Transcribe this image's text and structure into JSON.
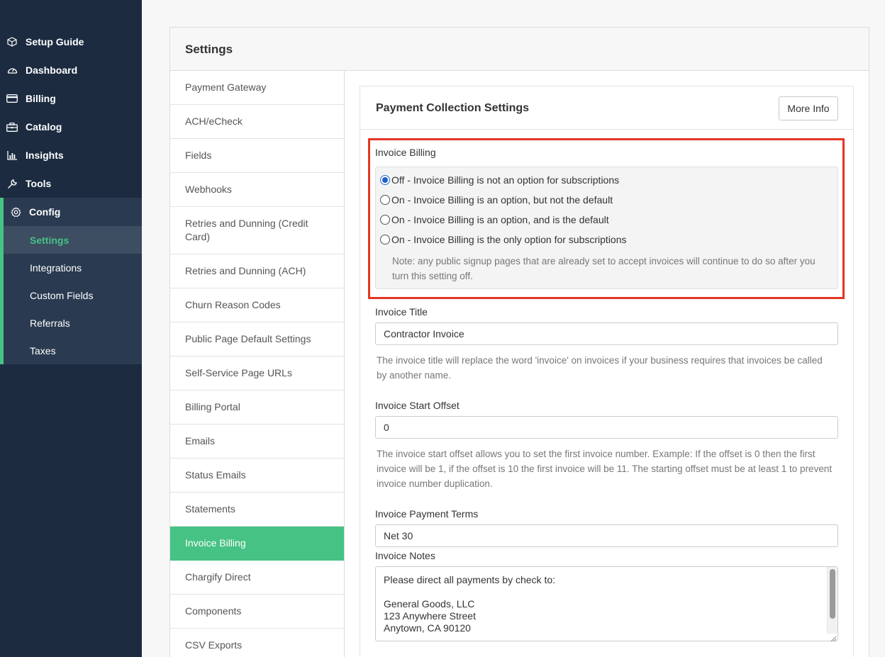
{
  "sidebar": {
    "items": [
      {
        "label": "Setup Guide",
        "icon": "cube-icon"
      },
      {
        "label": "Dashboard",
        "icon": "speedometer-icon"
      },
      {
        "label": "Billing",
        "icon": "credit-card-icon"
      },
      {
        "label": "Catalog",
        "icon": "catalog-icon"
      },
      {
        "label": "Insights",
        "icon": "bar-chart-icon"
      },
      {
        "label": "Tools",
        "icon": "wrench-icon"
      },
      {
        "label": "Config",
        "icon": "gear-icon"
      }
    ],
    "config_subitems": [
      {
        "label": "Settings",
        "active": true
      },
      {
        "label": "Integrations"
      },
      {
        "label": "Custom Fields"
      },
      {
        "label": "Referrals"
      },
      {
        "label": "Taxes"
      }
    ]
  },
  "settings": {
    "title": "Settings",
    "menu": [
      "Payment Gateway",
      "ACH/eCheck",
      "Fields",
      "Webhooks",
      "Retries and Dunning (Credit Card)",
      "Retries and Dunning (ACH)",
      "Churn Reason Codes",
      "Public Page Default Settings",
      "Self-Service Page URLs",
      "Billing Portal",
      "Emails",
      "Status Emails",
      "Statements",
      "Invoice Billing",
      "Chargify Direct",
      "Components",
      "CSV Exports"
    ],
    "active_menu": "Invoice Billing"
  },
  "panel": {
    "title": "Payment Collection Settings",
    "more_info_label": "More Info",
    "invoice_billing": {
      "label": "Invoice Billing",
      "options": [
        "Off - Invoice Billing is not an option for subscriptions",
        "On - Invoice Billing is an option, but not the default",
        "On - Invoice Billing is an option, and is the default",
        "On - Invoice Billing is the only option for subscriptions"
      ],
      "selected_index": 0,
      "note": "Note: any public signup pages that are already set to accept invoices will continue to do so after you turn this setting off."
    },
    "invoice_title": {
      "label": "Invoice Title",
      "value": "Contractor Invoice",
      "help": "The invoice title will replace the word 'invoice' on invoices if your business requires that invoices be called by another name."
    },
    "invoice_start_offset": {
      "label": "Invoice Start Offset",
      "value": "0",
      "help": "The invoice start offset allows you to set the first invoice number. Example: If the offset is 0 then the first invoice will be 1, if the offset is 10 the first invoice will be 11. The starting offset must be at least 1 to prevent invoice number duplication."
    },
    "invoice_payment_terms": {
      "label": "Invoice Payment Terms",
      "value": "Net 30"
    },
    "invoice_notes": {
      "label": "Invoice Notes",
      "lines": [
        "Please direct all payments by check to:",
        "",
        "General Goods, LLC",
        "123 Anywhere Street",
        "Anytown, CA 90120"
      ]
    }
  },
  "colors": {
    "sidebar_bg": "#1c2b40",
    "accent_green": "#46c284",
    "highlight_red": "#e33624",
    "radio_blue": "#1d5fc9"
  }
}
